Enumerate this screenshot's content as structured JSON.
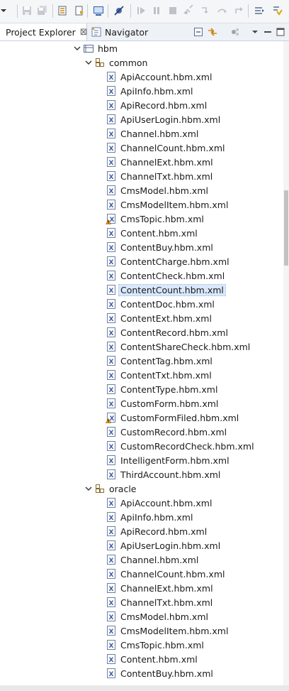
{
  "tabs": [
    {
      "label": "Project Explorer",
      "active": true,
      "close": "⊠"
    },
    {
      "label": "Navigator",
      "active": false
    }
  ],
  "toolbar_icons": [
    "new-dropdown-icon",
    "save-icon",
    "save-all-icon",
    "open-type-icon",
    "open-resource-icon",
    "console-icon",
    "skip-breakpoints-icon",
    "resume-icon",
    "suspend-icon",
    "terminate-icon",
    "disconnect-icon",
    "step-into-icon",
    "step-over-icon",
    "step-return-icon",
    "toggle-mark-icon",
    "next-annotation-icon"
  ],
  "view_icons": [
    "collapse-all-icon",
    "link-with-editor-icon",
    "filter-icon",
    "view-menu-icon",
    "minimize-icon",
    "maximize-icon"
  ],
  "tree": {
    "root": "hbm",
    "common": {
      "label": "common",
      "files": [
        "ApiAccount.hbm.xml",
        "ApiInfo.hbm.xml",
        "ApiRecord.hbm.xml",
        "ApiUserLogin.hbm.xml",
        "Channel.hbm.xml",
        "ChannelCount.hbm.xml",
        "ChannelExt.hbm.xml",
        "ChannelTxt.hbm.xml",
        "CmsModel.hbm.xml",
        "CmsModelItem.hbm.xml",
        "CmsTopic.hbm.xml",
        "Content.hbm.xml",
        "ContentBuy.hbm.xml",
        "ContentCharge.hbm.xml",
        "ContentCheck.hbm.xml",
        "ContentCount.hbm.xml",
        "ContentDoc.hbm.xml",
        "ContentExt.hbm.xml",
        "ContentRecord.hbm.xml",
        "ContentShareCheck.hbm.xml",
        "ContentTag.hbm.xml",
        "ContentTxt.hbm.xml",
        "ContentType.hbm.xml",
        "CustomForm.hbm.xml",
        "CustomFormFiled.hbm.xml",
        "CustomRecord.hbm.xml",
        "CustomRecordCheck.hbm.xml",
        "IntelligentForm.hbm.xml",
        "ThirdAccount.hbm.xml"
      ],
      "warning_files": [
        "CmsTopic.hbm.xml",
        "CustomFormFiled.hbm.xml"
      ],
      "selected": "ContentCount.hbm.xml"
    },
    "oracle": {
      "label": "oracle",
      "files": [
        "ApiAccount.hbm.xml",
        "ApiInfo.hbm.xml",
        "ApiRecord.hbm.xml",
        "ApiUserLogin.hbm.xml",
        "Channel.hbm.xml",
        "ChannelCount.hbm.xml",
        "ChannelExt.hbm.xml",
        "ChannelTxt.hbm.xml",
        "CmsModel.hbm.xml",
        "CmsModelItem.hbm.xml",
        "CmsTopic.hbm.xml",
        "Content.hbm.xml",
        "ContentBuy.hbm.xml"
      ]
    }
  },
  "colors": {
    "selection": "#d9e8fb",
    "warning": "#e8a317",
    "xml_icon": "#3a5da8",
    "package": "#8a6a2a"
  }
}
